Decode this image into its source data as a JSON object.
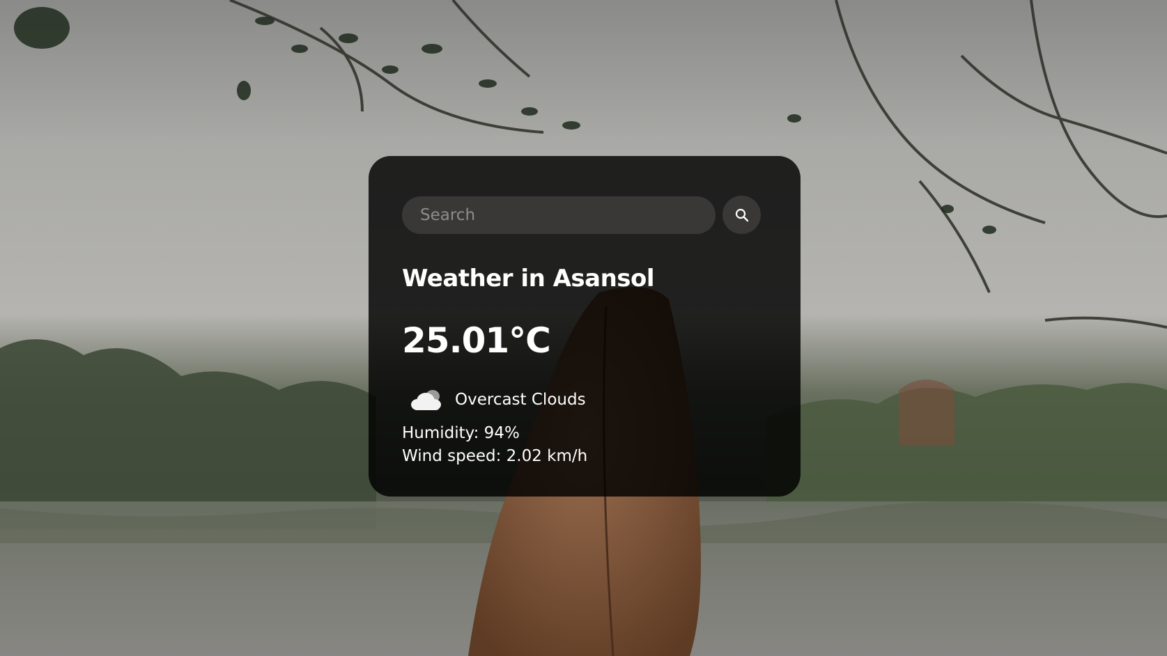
{
  "search": {
    "placeholder": "Search",
    "value": ""
  },
  "weather": {
    "city_heading": "Weather in Asansol",
    "temperature": "25.01°C",
    "description": "Overcast Clouds",
    "condition_icon": "cloud-icon",
    "humidity": "Humidity: 94%",
    "wind": "Wind speed: 2.02 km/h"
  },
  "colors": {
    "card_background": "#1c1a19",
    "input_background": "#3a3837",
    "text": "#ffffff"
  }
}
